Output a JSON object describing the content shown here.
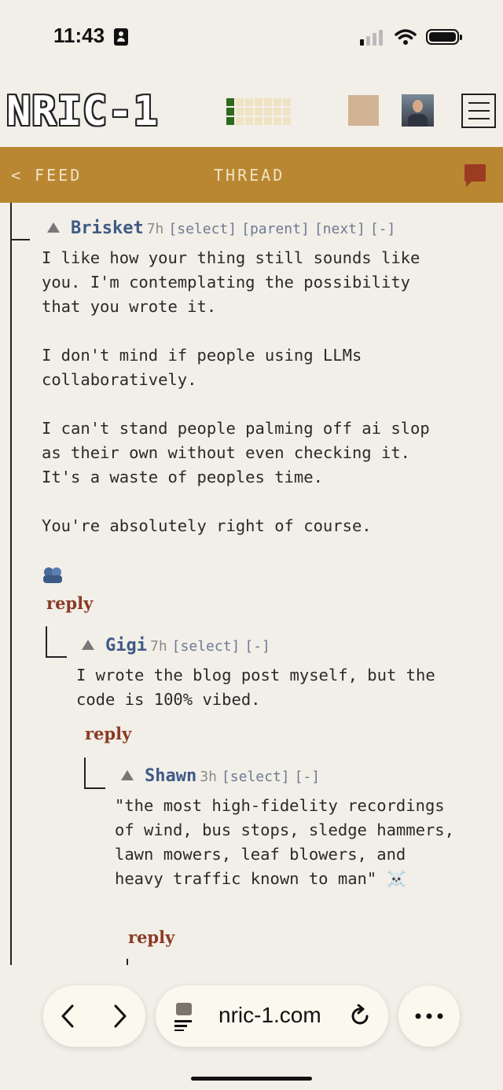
{
  "status_bar": {
    "time": "11:43"
  },
  "header": {
    "logo": "NRIC-1"
  },
  "nav": {
    "back": "< FEED",
    "title": "THREAD"
  },
  "comments": [
    {
      "author": "Brisket",
      "age": "7h",
      "links": [
        "[select]",
        "[parent]",
        "[next]",
        "[-]"
      ],
      "body": "I like how your thing still sounds like\nyou. I'm contemplating the possibility\nthat you wrote it.\n\nI don't mind if people using LLMs\ncollaboratively.\n\nI can't stand people palming off ai slop\nas their own without even checking it.\nIt's a waste of peoples time.\n\nYou're absolutely right of course.",
      "reply": "reply"
    },
    {
      "author": "Gigi",
      "age": "7h",
      "links": [
        "[select]",
        "[-]"
      ],
      "body": "I wrote the blog post myself, but the\ncode is 100% vibed.",
      "reply": "reply"
    },
    {
      "author": "Shawn",
      "age": "3h",
      "links": [
        "[select]",
        "[-]"
      ],
      "body": "\"the most high-fidelity recordings\nof wind, bus stops, sledge hammers,\nlawn mowers, leaf blowers, and\nheavy traffic known to man\" ☠️",
      "reply": "reply"
    }
  ],
  "browser": {
    "url": "nric-1.com"
  },
  "colors": {
    "nav_bg": "#b98732",
    "author": "#3f5a86",
    "reply": "#8b3a26",
    "activity_on": "#2d6a1f"
  }
}
